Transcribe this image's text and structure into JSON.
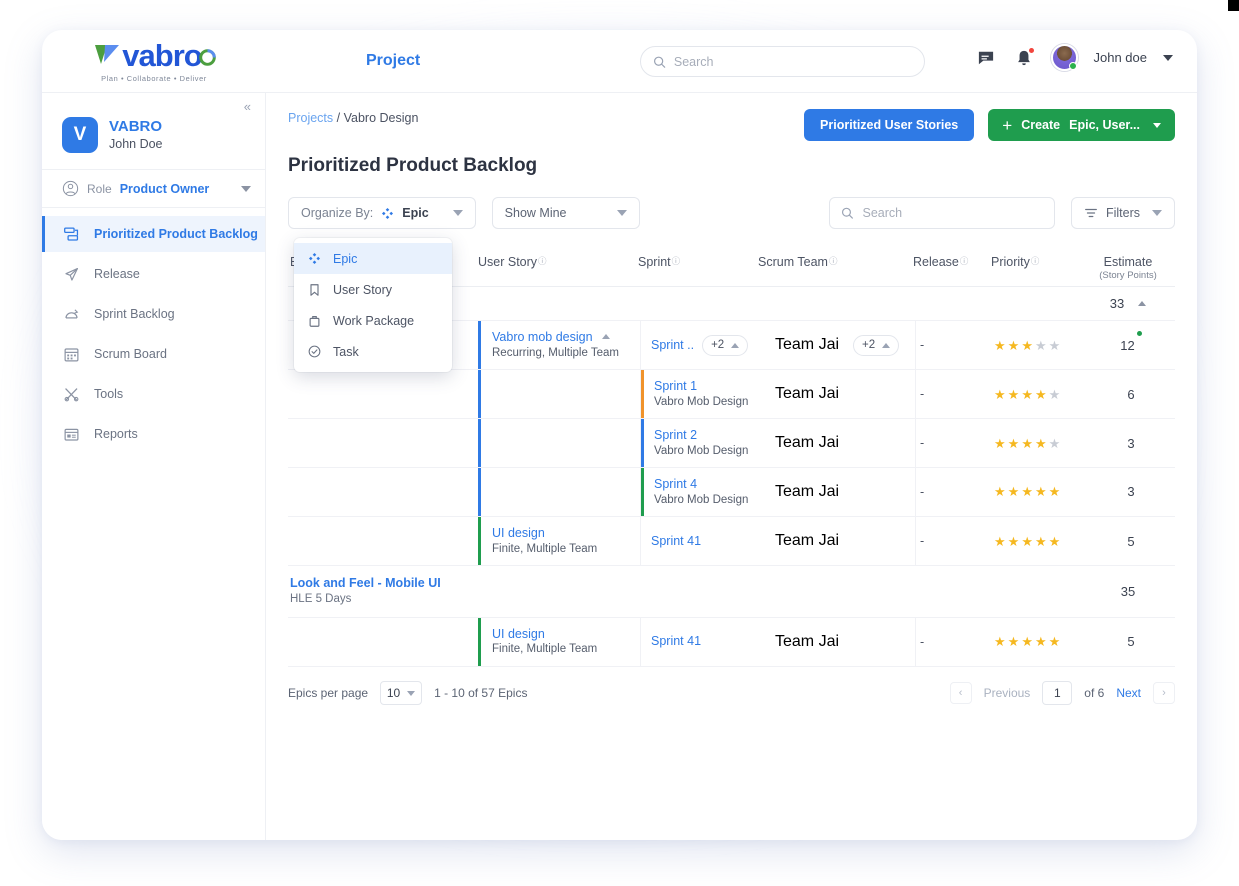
{
  "brand": {
    "logo_text": "vabro",
    "tagline": "Plan • Collaborate • Deliver"
  },
  "topbar": {
    "nav_label": "Project",
    "search_placeholder": "Search",
    "search_value": "",
    "user_name": "John doe",
    "icons": [
      "message-icon",
      "bell-icon"
    ]
  },
  "sidebar": {
    "collapse_label": "«",
    "project_badge": "V",
    "project_name": "VABRO",
    "project_owner": "John Doe",
    "role_label": "Role",
    "role_value": "Product Owner",
    "items": [
      {
        "label": "Prioritized Product Backlog",
        "icon": "backlog-icon",
        "active": true
      },
      {
        "label": "Release",
        "icon": "paper-plane-icon",
        "active": false
      },
      {
        "label": "Sprint Backlog",
        "icon": "sprint-icon",
        "active": false
      },
      {
        "label": "Scrum Board",
        "icon": "calendar-icon",
        "active": false
      },
      {
        "label": "Tools",
        "icon": "tools-icon",
        "active": false
      },
      {
        "label": "Reports",
        "icon": "reports-icon",
        "active": false
      }
    ]
  },
  "breadcrumb": {
    "root": "Projects",
    "separator": "/",
    "current": "Vabro Design"
  },
  "header_actions": {
    "prioritized_user_stories": "Prioritized User Stories",
    "create_label": "Create",
    "create_sub": "Epic, User...",
    "plus": "+"
  },
  "page": {
    "title": "Prioritized Product Backlog"
  },
  "toolbar": {
    "organize_by_label": "Organize By:",
    "organize_by_value": "Epic",
    "show_mine": "Show Mine",
    "search_placeholder": "Search",
    "search_value": "",
    "filters_label": "Filters"
  },
  "dropdown": {
    "open": true,
    "items": [
      {
        "label": "Epic",
        "icon": "epic-icon",
        "selected": true
      },
      {
        "label": "User Story",
        "icon": "bookmark-icon",
        "selected": false
      },
      {
        "label": "Work Package",
        "icon": "briefcase-icon",
        "selected": false
      },
      {
        "label": "Task",
        "icon": "check-circle-icon",
        "selected": false
      }
    ]
  },
  "table": {
    "columns": [
      {
        "label": "Epic",
        "info": true
      },
      {
        "label": "User Story",
        "info": true
      },
      {
        "label": "Sprint",
        "info": true
      },
      {
        "label": "Scrum Team",
        "info": true
      },
      {
        "label": "Release",
        "info": true
      },
      {
        "label": "Priority",
        "info": true
      },
      {
        "label": "Estimate",
        "sub": "(Story Points)",
        "info": false
      }
    ],
    "groups": [
      {
        "epic_title": "",
        "epic_sub": "",
        "estimate": "33",
        "sort_indicator": "▲",
        "accent": "#2f7ae5",
        "rows": [
          {
            "story_title": "Vabro mob design",
            "story_sub": "Recurring, Multiple Team",
            "story_collapse": true,
            "sprint_title": "Sprint ..",
            "sprint_chip": "+2",
            "sprint_sub": "",
            "sprint_accent": "",
            "team": "Team Jai",
            "team_chip": "+2",
            "release": "-",
            "priority": 3,
            "priority_max": 5,
            "estimate": "12",
            "estimate_dot": true
          },
          {
            "story_title": "",
            "story_sub": "",
            "sprint_title": "Sprint 1",
            "sprint_sub": "Vabro Mob Design",
            "sprint_accent": "#f0932b",
            "team": "Team Jai",
            "release": "-",
            "priority": 4,
            "priority_max": 5,
            "estimate": "6"
          },
          {
            "story_title": "",
            "story_sub": "",
            "sprint_title": "Sprint 2",
            "sprint_sub": "Vabro Mob Design",
            "sprint_accent": "#2f7ae5",
            "team": "Team Jai",
            "release": "-",
            "priority": 4,
            "priority_max": 5,
            "estimate": "3"
          },
          {
            "story_title": "",
            "story_sub": "",
            "sprint_title": "Sprint 4",
            "sprint_sub": "Vabro Mob Design",
            "sprint_accent": "#1f9d4e",
            "team": "Team Jai",
            "release": "-",
            "priority": 5,
            "priority_max": 5,
            "estimate": "3"
          },
          {
            "story_title": "UI design",
            "story_sub": "Finite, Multiple Team",
            "story_accent": "#1f9d4e",
            "sprint_title": "Sprint 41",
            "sprint_sub": "",
            "sprint_accent": "",
            "team": "Team Jai",
            "release": "-",
            "priority": 5,
            "priority_max": 5,
            "estimate": "5"
          }
        ]
      },
      {
        "epic_title": "Look and Feel - Mobile UI",
        "epic_sub": "HLE 5 Days",
        "estimate": "35",
        "accent": "#1f9d4e",
        "rows": [
          {
            "story_title": "UI design",
            "story_sub": "Finite, Multiple Team",
            "story_accent": "#1f9d4e",
            "sprint_title": "Sprint 41",
            "sprint_sub": "",
            "sprint_accent": "",
            "team": "Team Jai",
            "release": "-",
            "priority": 5,
            "priority_max": 5,
            "estimate": "5"
          }
        ]
      }
    ]
  },
  "footer": {
    "per_page_label": "Epics per page",
    "per_page_value": "10",
    "range_text": "1 - 10 of 57 Epics",
    "prev_arrow": "‹",
    "previous": "Previous",
    "page_value": "1",
    "of_text": "of 6",
    "next": "Next",
    "next_arrow": "›"
  },
  "colors": {
    "primary_blue": "#2f7ae5",
    "green": "#1f9d4e",
    "orange": "#f0932b",
    "star_gold": "#f5b820",
    "star_gray": "#c8ccd4"
  }
}
